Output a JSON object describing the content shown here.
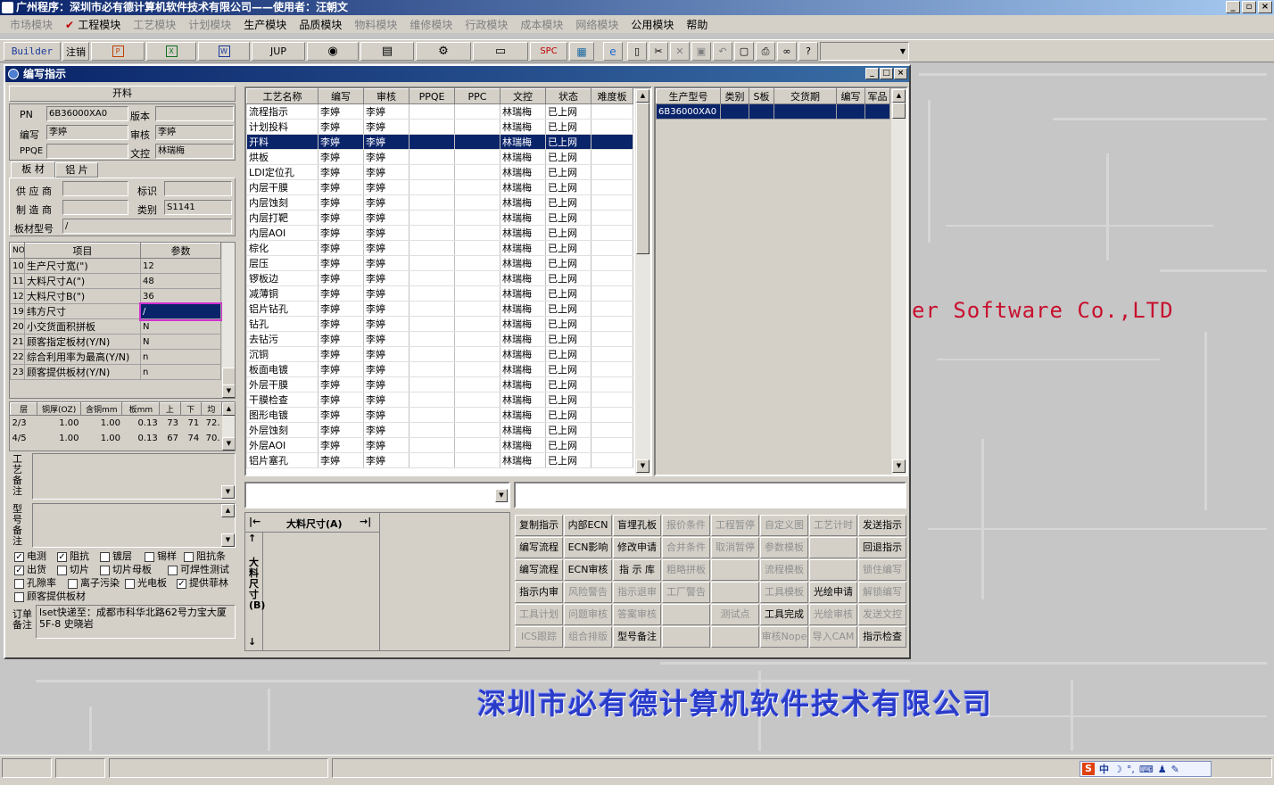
{
  "app": {
    "title": "广州程序：深圳市必有德计算机软件技术有限公司——使用者：汪朝文"
  },
  "menu": [
    {
      "label": "市场模块",
      "enabled": false
    },
    {
      "label": "工程模块",
      "enabled": true,
      "checked": true
    },
    {
      "label": "工艺模块",
      "enabled": false
    },
    {
      "label": "计划模块",
      "enabled": false
    },
    {
      "label": "生产模块",
      "enabled": true
    },
    {
      "label": "品质模块",
      "enabled": true
    },
    {
      "label": "物料模块",
      "enabled": false
    },
    {
      "label": "维修模块",
      "enabled": false
    },
    {
      "label": "行政模块",
      "enabled": false
    },
    {
      "label": "成本模块",
      "enabled": false
    },
    {
      "label": "网络模块",
      "enabled": false
    },
    {
      "label": "公用模块",
      "enabled": true
    },
    {
      "label": "帮助",
      "enabled": true
    }
  ],
  "toolbar": {
    "builder": "Builder",
    "logout": "注销",
    "jup": "JUP",
    "spc": "SPC",
    "combo": ""
  },
  "background": {
    "company_en": "er Software Co.,LTD",
    "company_cn": "深圳市必有德计算机软件技术有限公司"
  },
  "dialog": {
    "title": "编写指示",
    "section": "开料",
    "pn_label": "PN",
    "pn": "6B36000XA0",
    "version_label": "版本",
    "version": "",
    "author_label": "编写",
    "author": "李婷",
    "reviewer_label": "审核",
    "reviewer": "李婷",
    "ppqe_label": "PPQE",
    "ppqe": "",
    "doc_label": "文控",
    "doc": "林瑞梅",
    "tabs": [
      "板 材",
      "铝 片"
    ],
    "supplier_label": "供 应 商",
    "supplier": "",
    "mark_label": "标识",
    "mark": "",
    "maker_label": "制 造 商",
    "maker": "",
    "category_label": "类别",
    "category": "S1141",
    "board_type_label": "板材型号",
    "board_type": "/",
    "param_headers": [
      "NO",
      "项目",
      "参数"
    ],
    "params": [
      {
        "no": "10",
        "item": "生产尺寸宽(\")",
        "value": "12"
      },
      {
        "no": "11",
        "item": "大料尺寸A(\")",
        "value": "48"
      },
      {
        "no": "12",
        "item": "大料尺寸B(\")",
        "value": "36"
      },
      {
        "no": "19",
        "item": "纬方尺寸",
        "value": "/"
      },
      {
        "no": "20",
        "item": "小交货面积拼板",
        "value": "N"
      },
      {
        "no": "21",
        "item": "顾客指定板材(Y/N)",
        "value": "N"
      },
      {
        "no": "22",
        "item": "综合利用率为最高(Y/N)",
        "value": "n"
      },
      {
        "no": "23",
        "item": "顾客提供板材(Y/N)",
        "value": "n"
      }
    ],
    "layer_headers": [
      "层",
      "铜厚(OZ)",
      "含铜mm",
      "板mm",
      "上",
      "下",
      "均"
    ],
    "layers": [
      [
        "2/3",
        "1.00",
        "1.00",
        "0.13",
        "73",
        "71",
        "72."
      ],
      [
        "4/5",
        "1.00",
        "1.00",
        "0.13",
        "67",
        "74",
        "70."
      ]
    ],
    "craft_note_label": "工艺备注",
    "craft_note": "",
    "model_note_label": "型号备注",
    "model_note": "",
    "checks": [
      {
        "label": "电测",
        "checked": true
      },
      {
        "label": "阻抗",
        "checked": true
      },
      {
        "label": "镀层",
        "checked": false
      },
      {
        "label": "锡样",
        "checked": false
      },
      {
        "label": "阻抗条",
        "checked": false
      },
      {
        "label": "出货",
        "checked": true
      },
      {
        "label": "切片",
        "checked": false
      },
      {
        "label": "切片母板",
        "checked": false
      },
      {
        "label": "可焊性测试",
        "checked": false
      },
      {
        "label": "孔隙率",
        "checked": false
      },
      {
        "label": "离子污染",
        "checked": false
      },
      {
        "label": "光电板",
        "checked": false
      },
      {
        "label": "提供菲林",
        "checked": true
      },
      {
        "label": "顾客提供板材",
        "checked": false
      }
    ],
    "order_note_label": "订单备注",
    "order_note": "lset快递至：成都市科华北路62号力宝大厦5F-8  史晓岩",
    "process_headers": [
      "工艺名称",
      "编写",
      "审核",
      "PPQE",
      "PPC",
      "文控",
      "状态",
      "难度板"
    ],
    "processes": [
      [
        "流程指示",
        "李婷",
        "李婷",
        "",
        "",
        "林瑞梅",
        "已上网",
        ""
      ],
      [
        "计划投料",
        "李婷",
        "李婷",
        "",
        "",
        "林瑞梅",
        "已上网",
        ""
      ],
      [
        "开料",
        "李婷",
        "李婷",
        "",
        "",
        "林瑞梅",
        "已上网",
        ""
      ],
      [
        "烘板",
        "李婷",
        "李婷",
        "",
        "",
        "林瑞梅",
        "已上网",
        ""
      ],
      [
        "LDI定位孔",
        "李婷",
        "李婷",
        "",
        "",
        "林瑞梅",
        "已上网",
        ""
      ],
      [
        "内层干膜",
        "李婷",
        "李婷",
        "",
        "",
        "林瑞梅",
        "已上网",
        ""
      ],
      [
        "内层蚀刻",
        "李婷",
        "李婷",
        "",
        "",
        "林瑞梅",
        "已上网",
        ""
      ],
      [
        "内层打靶",
        "李婷",
        "李婷",
        "",
        "",
        "林瑞梅",
        "已上网",
        ""
      ],
      [
        "内层AOI",
        "李婷",
        "李婷",
        "",
        "",
        "林瑞梅",
        "已上网",
        ""
      ],
      [
        "棕化",
        "李婷",
        "李婷",
        "",
        "",
        "林瑞梅",
        "已上网",
        ""
      ],
      [
        "层压",
        "李婷",
        "李婷",
        "",
        "",
        "林瑞梅",
        "已上网",
        ""
      ],
      [
        "锣板边",
        "李婷",
        "李婷",
        "",
        "",
        "林瑞梅",
        "已上网",
        ""
      ],
      [
        "减薄铜",
        "李婷",
        "李婷",
        "",
        "",
        "林瑞梅",
        "已上网",
        ""
      ],
      [
        "铝片钻孔",
        "李婷",
        "李婷",
        "",
        "",
        "林瑞梅",
        "已上网",
        ""
      ],
      [
        "钻孔",
        "李婷",
        "李婷",
        "",
        "",
        "林瑞梅",
        "已上网",
        ""
      ],
      [
        "去钻污",
        "李婷",
        "李婷",
        "",
        "",
        "林瑞梅",
        "已上网",
        ""
      ],
      [
        "沉铜",
        "李婷",
        "李婷",
        "",
        "",
        "林瑞梅",
        "已上网",
        ""
      ],
      [
        "板面电镀",
        "李婷",
        "李婷",
        "",
        "",
        "林瑞梅",
        "已上网",
        ""
      ],
      [
        "外层干膜",
        "李婷",
        "李婷",
        "",
        "",
        "林瑞梅",
        "已上网",
        ""
      ],
      [
        "干膜检查",
        "李婷",
        "李婷",
        "",
        "",
        "林瑞梅",
        "已上网",
        ""
      ],
      [
        "图形电镀",
        "李婷",
        "李婷",
        "",
        "",
        "林瑞梅",
        "已上网",
        ""
      ],
      [
        "外层蚀刻",
        "李婷",
        "李婷",
        "",
        "",
        "林瑞梅",
        "已上网",
        ""
      ],
      [
        "外层AOI",
        "李婷",
        "李婷",
        "",
        "",
        "林瑞梅",
        "已上网",
        ""
      ],
      [
        "铝片塞孔",
        "李婷",
        "李婷",
        "",
        "",
        "林瑞梅",
        "已上网",
        ""
      ]
    ],
    "selected_process": 2,
    "model_headers": [
      "生产型号",
      "类别",
      "S板",
      "交货期",
      "编写",
      "军品"
    ],
    "models": [
      [
        "6B36000XA0",
        "",
        "",
        "",
        "",
        ""
      ]
    ],
    "dim_a": "大料尺寸(A)",
    "dim_b": "大料尺寸(B)",
    "actions": [
      [
        {
          "label": "复制指示",
          "enabled": true
        },
        {
          "label": "内部ECN",
          "enabled": true
        },
        {
          "label": "盲埋孔板",
          "enabled": true
        },
        {
          "label": "报价条件",
          "enabled": false
        },
        {
          "label": "工程暂停",
          "enabled": false
        },
        {
          "label": "自定义图",
          "enabled": false
        },
        {
          "label": "工艺计时",
          "enabled": false
        },
        {
          "label": "发送指示",
          "enabled": true
        }
      ],
      [
        {
          "label": "编写流程",
          "enabled": true
        },
        {
          "label": "ECN影响",
          "enabled": true
        },
        {
          "label": "修改申请",
          "enabled": true
        },
        {
          "label": "合并条件",
          "enabled": false
        },
        {
          "label": "取消暂停",
          "enabled": false
        },
        {
          "label": "参数模板",
          "enabled": false
        },
        {
          "label": "",
          "enabled": false
        },
        {
          "label": "回退指示",
          "enabled": true
        }
      ],
      [
        {
          "label": "编写流程",
          "enabled": true
        },
        {
          "label": "ECN审核",
          "enabled": true
        },
        {
          "label": "指 示 库",
          "enabled": true
        },
        {
          "label": "粗略拼板",
          "enabled": false
        },
        {
          "label": "",
          "enabled": false
        },
        {
          "label": "流程模板",
          "enabled": false
        },
        {
          "label": "",
          "enabled": false
        },
        {
          "label": "锁住编写",
          "enabled": false
        }
      ],
      [
        {
          "label": "指示内审",
          "enabled": true
        },
        {
          "label": "风险警告",
          "enabled": false
        },
        {
          "label": "指示退审",
          "enabled": false
        },
        {
          "label": "工厂警告",
          "enabled": false
        },
        {
          "label": "",
          "enabled": false
        },
        {
          "label": "工具模板",
          "enabled": false
        },
        {
          "label": "光绘申请",
          "enabled": true
        },
        {
          "label": "解锁编写",
          "enabled": false
        }
      ],
      [
        {
          "label": "工具计划",
          "enabled": false
        },
        {
          "label": "问题审核",
          "enabled": false
        },
        {
          "label": "答案审核",
          "enabled": false
        },
        {
          "label": "",
          "enabled": false
        },
        {
          "label": "测试点",
          "enabled": false
        },
        {
          "label": "工具完成",
          "enabled": true
        },
        {
          "label": "光绘审核",
          "enabled": false
        },
        {
          "label": "发送文控",
          "enabled": false
        }
      ],
      [
        {
          "label": "ICS跟踪",
          "enabled": false
        },
        {
          "label": "组合排版",
          "enabled": false
        },
        {
          "label": "型号备注",
          "enabled": true
        },
        {
          "label": "",
          "enabled": false
        },
        {
          "label": "",
          "enabled": false
        },
        {
          "label": "审核Nope",
          "enabled": false
        },
        {
          "label": "导入CAM",
          "enabled": false
        },
        {
          "label": "指示检查",
          "enabled": true
        }
      ]
    ]
  },
  "tray": {
    "ime": "中"
  }
}
